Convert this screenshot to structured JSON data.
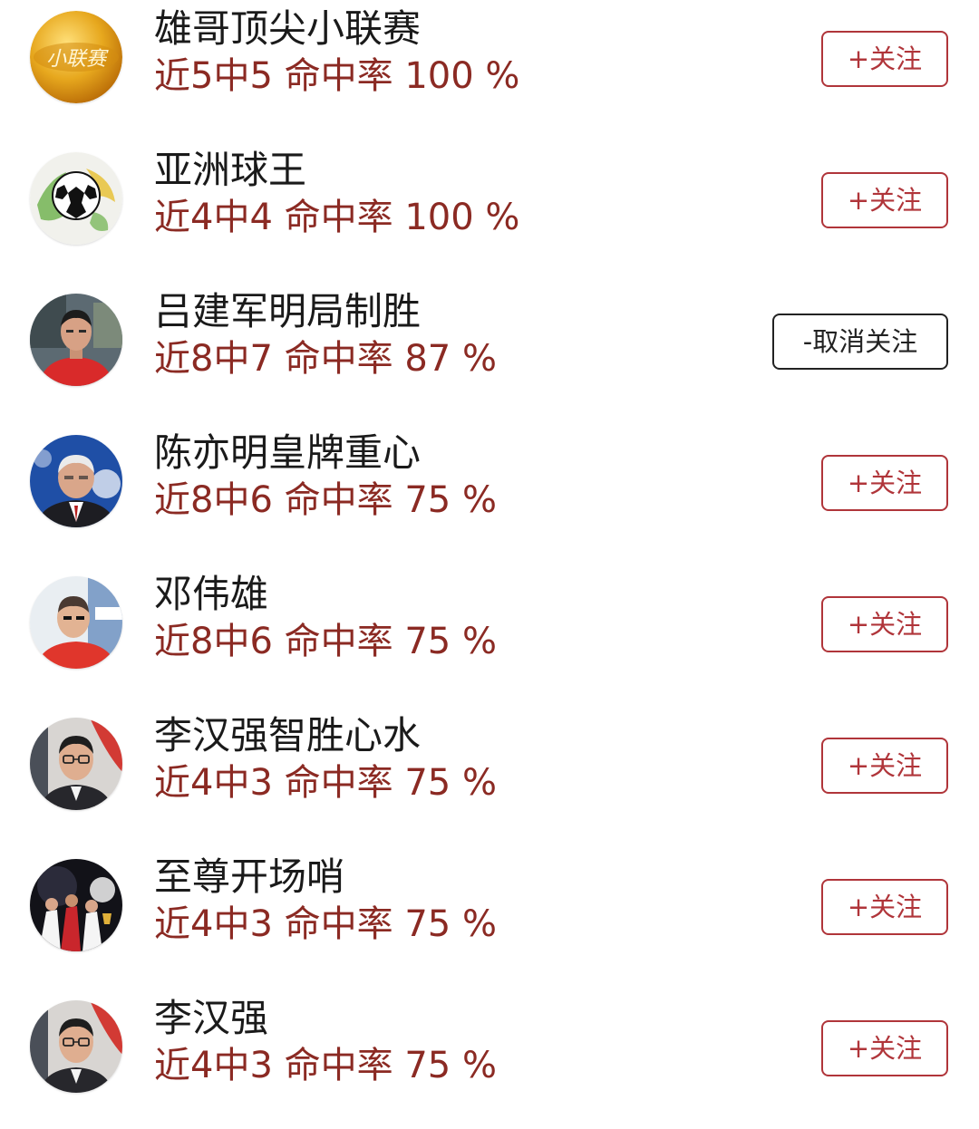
{
  "colors": {
    "stat_text": "#8b2a23",
    "follow_accent": "#b0353a",
    "unfollow_border": "#222222"
  },
  "experts": [
    {
      "name": "雄哥顶尖小联赛",
      "stat": "近5中5 命中率 100 %",
      "button": "+关注",
      "followed": false,
      "avatar": "gold-coin-logo-avatar",
      "avatar_text": "小联赛"
    },
    {
      "name": "亚洲球王",
      "stat": "近4中4 命中率 100 %",
      "button": "+关注",
      "followed": false,
      "avatar": "soccer-ball-avatar"
    },
    {
      "name": "吕建军明局制胜",
      "stat": "近8中7 命中率 87 %",
      "button": "-取消关注",
      "followed": true,
      "avatar": "man-red-shirt-avatar"
    },
    {
      "name": "陈亦明皇牌重心",
      "stat": "近8中6 命中率 75 %",
      "button": "+关注",
      "followed": false,
      "avatar": "man-suit-blue-avatar"
    },
    {
      "name": "邓伟雄",
      "stat": "近8中6 命中率 75 %",
      "button": "+关注",
      "followed": false,
      "avatar": "man-red-jersey-avatar"
    },
    {
      "name": "李汉强智胜心水",
      "stat": "近4中3 命中率 75 %",
      "button": "+关注",
      "followed": false,
      "avatar": "man-glasses-avatar"
    },
    {
      "name": "至尊开场哨",
      "stat": "近4中3 命中率 75 %",
      "button": "+关注",
      "followed": false,
      "avatar": "champions-team-avatar"
    },
    {
      "name": "李汉强",
      "stat": "近4中3 命中率 75 %",
      "button": "+关注",
      "followed": false,
      "avatar": "man-glasses-avatar"
    }
  ]
}
